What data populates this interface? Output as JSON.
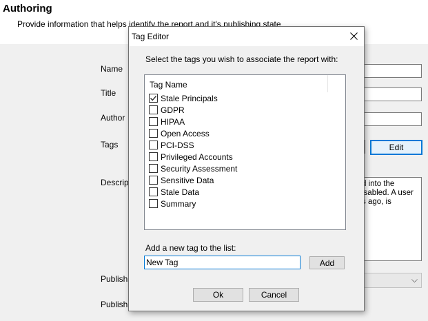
{
  "page": {
    "title": "Authoring",
    "subtitle": "Provide information that helps identify the report and it's publishing state"
  },
  "form": {
    "name_label": "Name",
    "title_label": "Title",
    "author_label": "Author",
    "tags_label": "Tags",
    "description_label": "Descrip",
    "publish_label_1": "Publish",
    "publish_label_2": "Publish",
    "edit_button": "Edit",
    "description_lines": [
      "d into the",
      "isabled. A user",
      "s ago, is"
    ],
    "combo_arrow": "⌵"
  },
  "dialog": {
    "title": "Tag Editor",
    "instruction": "Select the tags you wish to associate the report with:",
    "column_header": "Tag Name",
    "tags": [
      {
        "label": "Stale Principals",
        "checked": true
      },
      {
        "label": "GDPR",
        "checked": false
      },
      {
        "label": "HIPAA",
        "checked": false
      },
      {
        "label": "Open Access",
        "checked": false
      },
      {
        "label": "PCI-DSS",
        "checked": false
      },
      {
        "label": "Privileged Accounts",
        "checked": false
      },
      {
        "label": "Security Assessment",
        "checked": false
      },
      {
        "label": "Sensitive Data",
        "checked": false
      },
      {
        "label": "Stale Data",
        "checked": false
      },
      {
        "label": "Summary",
        "checked": false
      }
    ],
    "add_label": "Add a new tag to the list:",
    "new_tag_value": "New Tag",
    "add_button": "Add",
    "ok_button": "Ok",
    "cancel_button": "Cancel"
  }
}
